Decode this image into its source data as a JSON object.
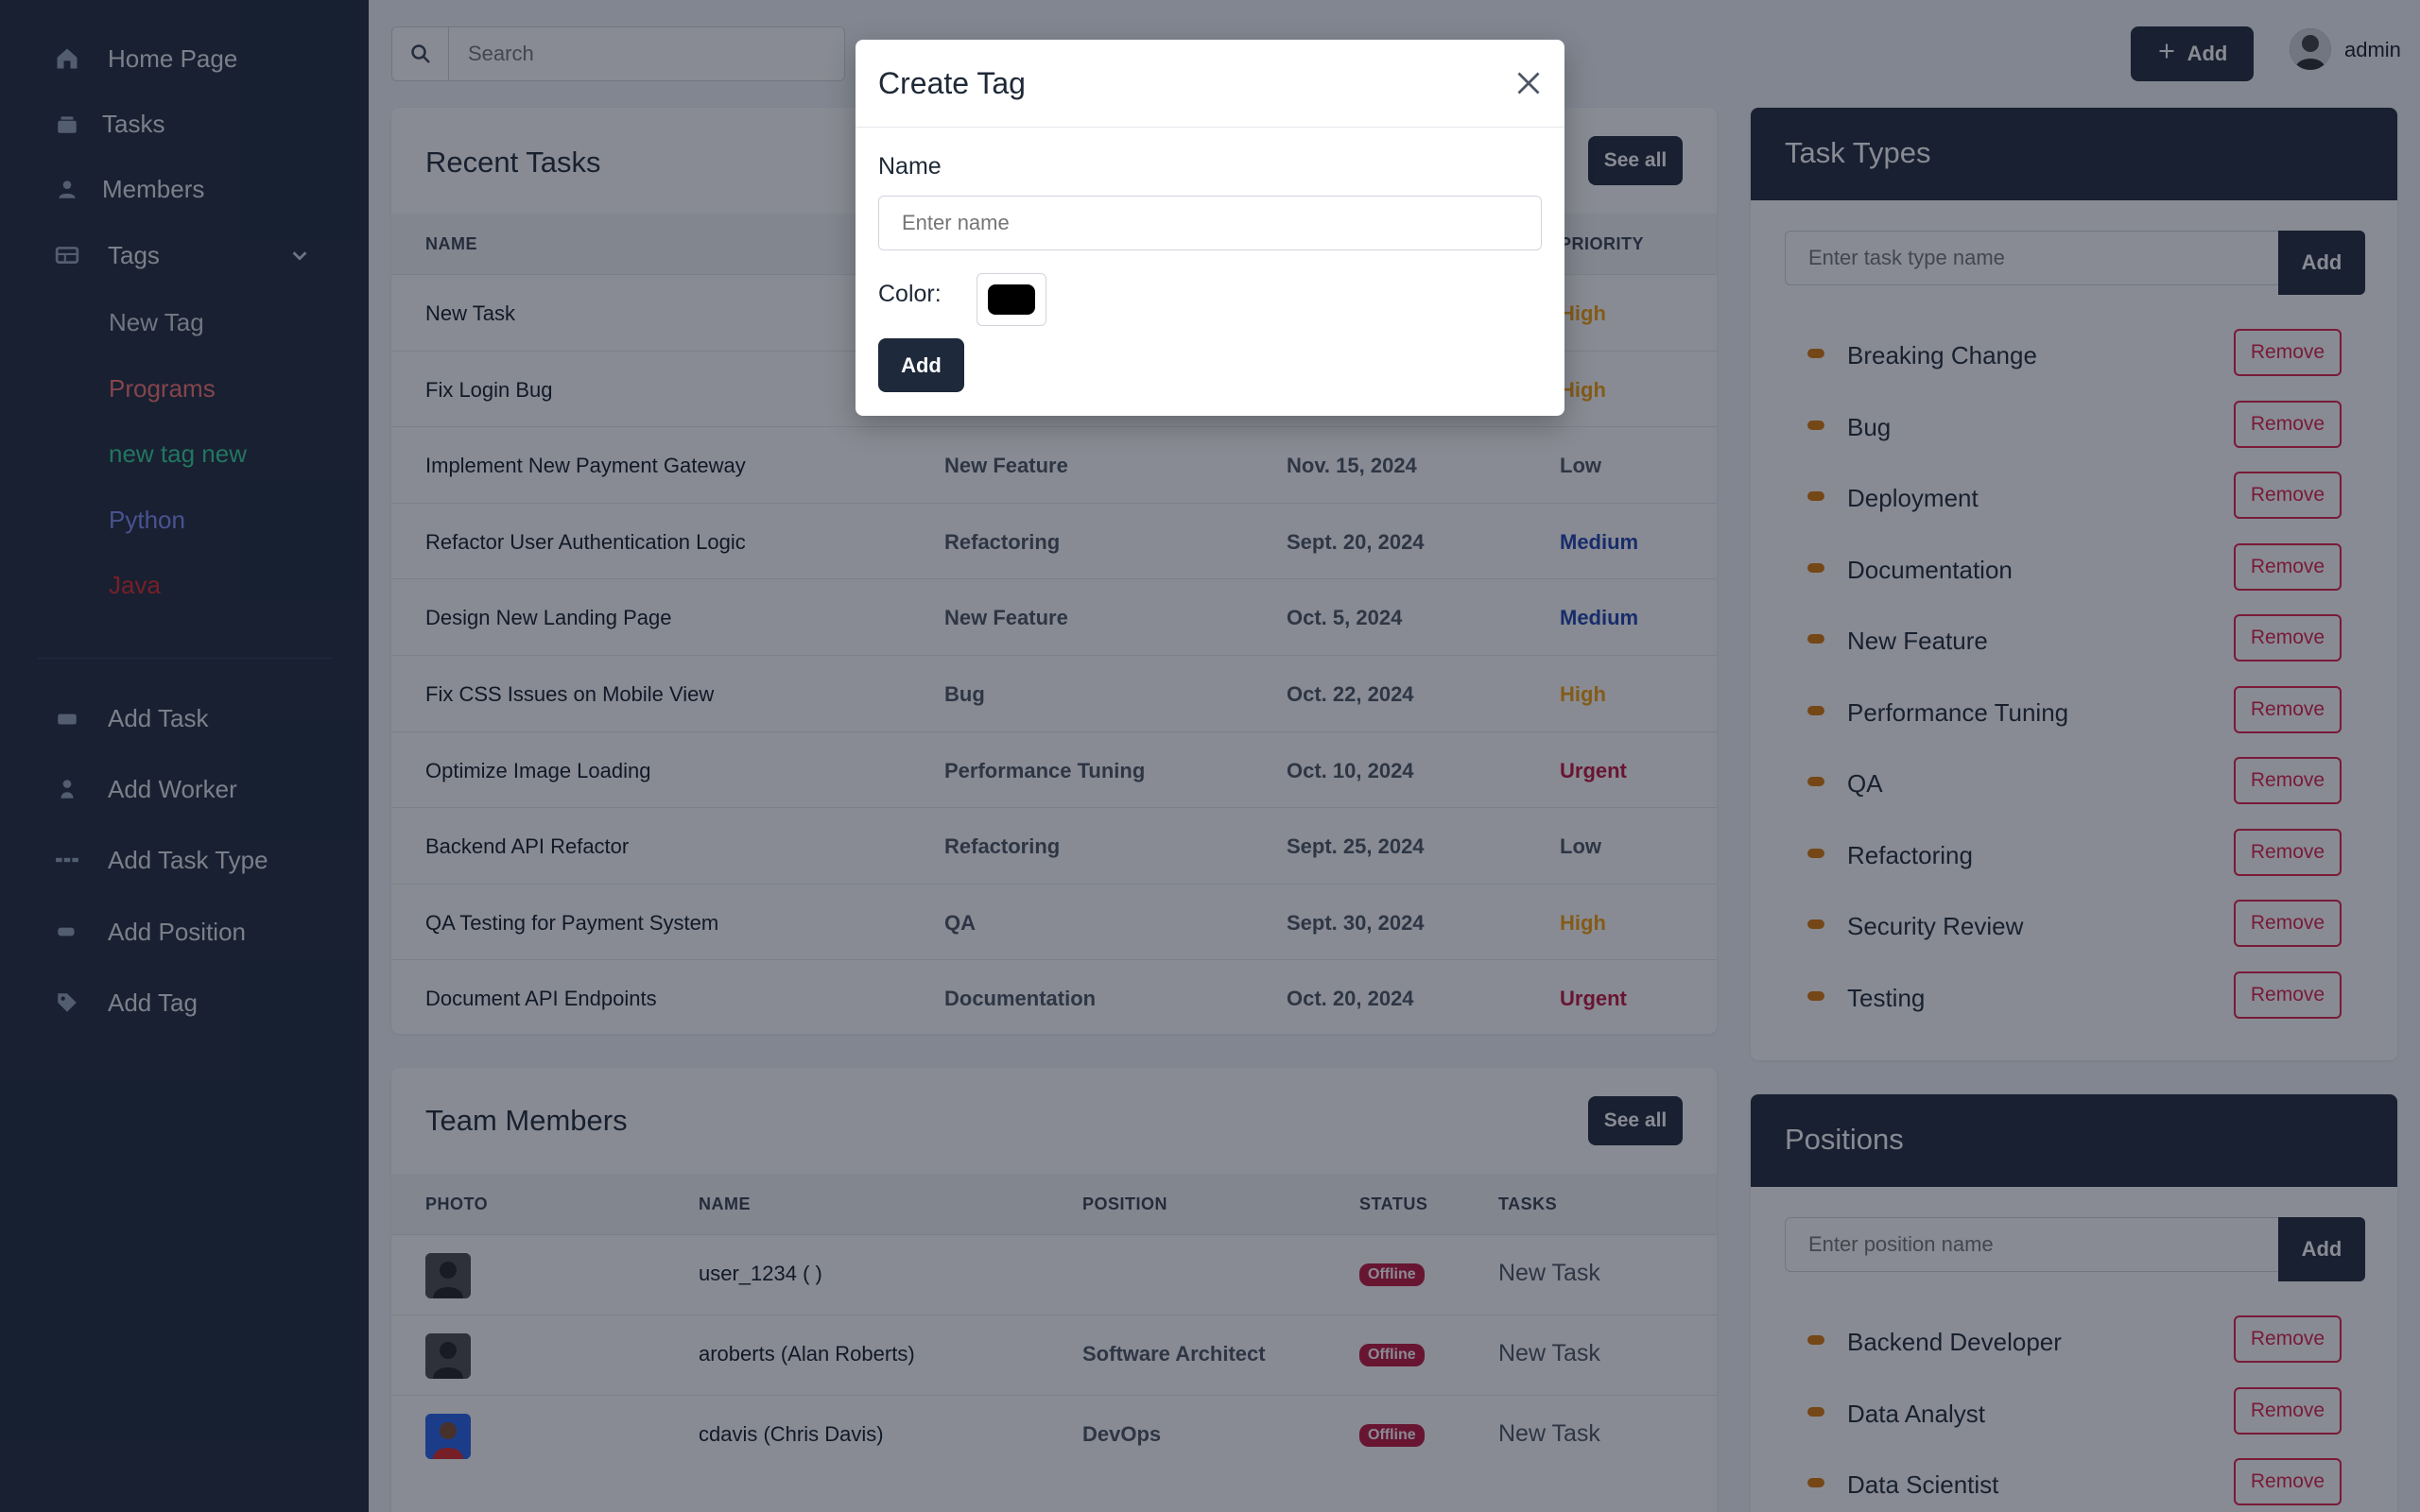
{
  "sidebar": {
    "nav": [
      {
        "label": "Home Page",
        "icon": "home-icon"
      },
      {
        "label": "Tasks",
        "icon": "tasks-icon"
      },
      {
        "label": "Members",
        "icon": "members-icon"
      },
      {
        "label": "Tags",
        "icon": "tags-icon"
      }
    ],
    "tags": [
      {
        "label": "New Tag",
        "color": "#d1d5db"
      },
      {
        "label": "Programs",
        "color": "#f87171"
      },
      {
        "label": "new tag new",
        "color": "#34d399"
      },
      {
        "label": "Python",
        "color": "#818cf8"
      },
      {
        "label": "Java",
        "color": "#dc2626"
      }
    ],
    "actions": [
      {
        "label": "Add Task",
        "icon": "add-task-icon"
      },
      {
        "label": "Add Worker",
        "icon": "add-worker-icon"
      },
      {
        "label": "Add Task Type",
        "icon": "add-task-type-icon"
      },
      {
        "label": "Add Position",
        "icon": "add-position-icon"
      },
      {
        "label": "Add Tag",
        "icon": "add-tag-icon"
      }
    ]
  },
  "topbar": {
    "search_placeholder": "Search",
    "add_label": "Add",
    "user": "admin"
  },
  "recent_tasks": {
    "title": "Recent Tasks",
    "see_all": "See all",
    "headers": {
      "name": "NAME",
      "priority": "PRIORITY"
    },
    "rows": [
      {
        "name": "New Task",
        "type": "",
        "date": "",
        "priority": "High",
        "pcolor": "#f59e0b"
      },
      {
        "name": "Fix Login Bug",
        "type": "",
        "date": "",
        "priority": "High",
        "pcolor": "#f59e0b"
      },
      {
        "name": "Implement New Payment Gateway",
        "type": "New Feature",
        "date": "Nov. 15, 2024",
        "priority": "Low",
        "pcolor": "#4b5563"
      },
      {
        "name": "Refactor User Authentication Logic",
        "type": "Refactoring",
        "date": "Sept. 20, 2024",
        "priority": "Medium",
        "pcolor": "#1e40af"
      },
      {
        "name": "Design New Landing Page",
        "type": "New Feature",
        "date": "Oct. 5, 2024",
        "priority": "Medium",
        "pcolor": "#1e40af"
      },
      {
        "name": "Fix CSS Issues on Mobile View",
        "type": "Bug",
        "date": "Oct. 22, 2024",
        "priority": "High",
        "pcolor": "#f59e0b"
      },
      {
        "name": "Optimize Image Loading",
        "type": "Performance Tuning",
        "date": "Oct. 10, 2024",
        "priority": "Urgent",
        "pcolor": "#be123c"
      },
      {
        "name": "Backend API Refactor",
        "type": "Refactoring",
        "date": "Sept. 25, 2024",
        "priority": "Low",
        "pcolor": "#4b5563"
      },
      {
        "name": "QA Testing for Payment System",
        "type": "QA",
        "date": "Sept. 30, 2024",
        "priority": "High",
        "pcolor": "#f59e0b"
      },
      {
        "name": "Document API Endpoints",
        "type": "Documentation",
        "date": "Oct. 20, 2024",
        "priority": "Urgent",
        "pcolor": "#be123c"
      }
    ]
  },
  "team_members": {
    "title": "Team Members",
    "see_all": "See all",
    "headers": {
      "photo": "PHOTO",
      "name": "NAME",
      "position": "POSITION",
      "status": "STATUS",
      "tasks": "TASKS"
    },
    "rows": [
      {
        "name": "user_1234 ( )",
        "position": "",
        "status": "Offline",
        "tasks": "New Task"
      },
      {
        "name": "aroberts (Alan Roberts)",
        "position": "Software Architect",
        "status": "Offline",
        "tasks": "New Task"
      },
      {
        "name": "cdavis (Chris Davis)",
        "position": "DevOps",
        "status": "Offline",
        "tasks": "New Task"
      }
    ]
  },
  "task_types": {
    "title": "Task Types",
    "placeholder": "Enter task type name",
    "add_label": "Add",
    "remove_label": "Remove",
    "items": [
      "Breaking Change",
      "Bug",
      "Deployment",
      "Documentation",
      "New Feature",
      "Performance Tuning",
      "QA",
      "Refactoring",
      "Security Review",
      "Testing"
    ]
  },
  "positions": {
    "title": "Positions",
    "placeholder": "Enter position name",
    "add_label": "Add",
    "remove_label": "Remove",
    "items": [
      "Backend Developer",
      "Data Analyst",
      "Data Scientist"
    ]
  },
  "modal": {
    "title": "Create Tag",
    "name_label": "Name",
    "name_placeholder": "Enter name",
    "color_label": "Color:",
    "color_value": "#000000",
    "add_label": "Add"
  }
}
